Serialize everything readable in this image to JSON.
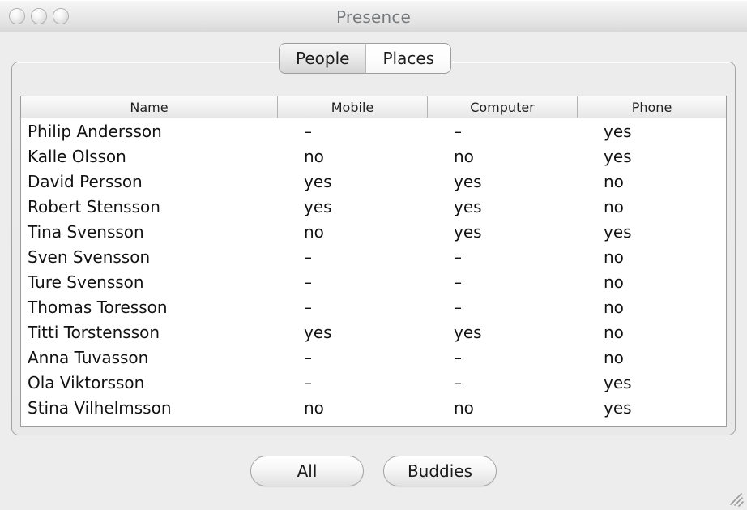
{
  "window": {
    "title": "Presence",
    "controls": [
      {
        "name": "close-button",
        "label": ""
      },
      {
        "name": "minimize-button",
        "label": ""
      },
      {
        "name": "zoom-button",
        "label": ""
      }
    ]
  },
  "tabs": [
    {
      "label": "People",
      "selected": false
    },
    {
      "label": "Places",
      "selected": true
    }
  ],
  "table": {
    "columns": [
      "Name",
      "Mobile",
      "Computer",
      "Phone"
    ],
    "rows": [
      [
        "Philip Andersson",
        "–",
        "–",
        "yes"
      ],
      [
        "Kalle Olsson",
        "no",
        "no",
        "yes"
      ],
      [
        "David Persson",
        "yes",
        "yes",
        "no"
      ],
      [
        "Robert Stensson",
        "yes",
        "yes",
        "no"
      ],
      [
        "Tina Svensson",
        "no",
        "yes",
        "yes"
      ],
      [
        "Sven Svensson",
        "–",
        "–",
        "no"
      ],
      [
        "Ture Svensson",
        "–",
        "–",
        "no"
      ],
      [
        "Thomas Toresson",
        "–",
        "–",
        "no"
      ],
      [
        "Titti Torstensson",
        "yes",
        "yes",
        "no"
      ],
      [
        "Anna Tuvasson",
        "–",
        "–",
        "no"
      ],
      [
        "Ola Viktorsson",
        "–",
        "–",
        "yes"
      ],
      [
        "Stina Vilhelmsson",
        "no",
        "no",
        "yes"
      ]
    ]
  },
  "footer": {
    "buttons": [
      {
        "label": "All"
      },
      {
        "label": "Buddies"
      }
    ]
  },
  "colors": {
    "window_background": "#ededed",
    "table_background": "#ffffff",
    "title_text": "#76797c",
    "body_text": "#121212"
  }
}
